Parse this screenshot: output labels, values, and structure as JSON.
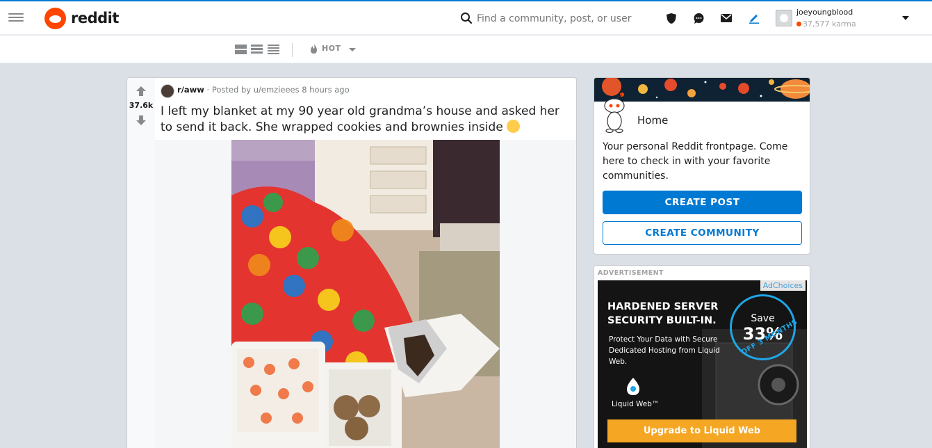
{
  "app": {
    "logo_text": "reddit",
    "accent_color": "#ff4500",
    "link_color": "#0079d3"
  },
  "header": {
    "search_placeholder": "Find a community, post, or user",
    "icons": [
      "hamburger-icon",
      "search-icon",
      "shield-icon",
      "chat-icon",
      "mail-icon",
      "pencil-icon"
    ],
    "user": {
      "name": "joeyoungblood",
      "karma": "37,577 karma"
    }
  },
  "subbar": {
    "sort_label": "HOT"
  },
  "post": {
    "votes": "37.6k",
    "subreddit": "r/aww",
    "meta": "· Posted by u/emzieees 8 hours ago",
    "title": "I left my blanket at my 90 year old grandma’s house and asked her to send it back. She wrapped cookies and brownies inside"
  },
  "sidebar": {
    "home_title": "Home",
    "home_desc": "Your personal Reddit frontpage. Come here to check in with your favorite communities.",
    "create_post": "CREATE POST",
    "create_community": "CREATE COMMUNITY"
  },
  "ad": {
    "label": "ADVERTISEMENT",
    "adchoices": "AdChoices",
    "headline": "HARDENED SERVER SECURITY BUILT-IN.",
    "subtext": "Protect Your Data with Secure Dedicated Hosting from Liquid Web.",
    "save_word": "Save",
    "save_pct": "33%",
    "save_off": "OFF 3 MONTHS",
    "brand": "Liquid Web™",
    "cta": "Upgrade to Liquid Web"
  }
}
